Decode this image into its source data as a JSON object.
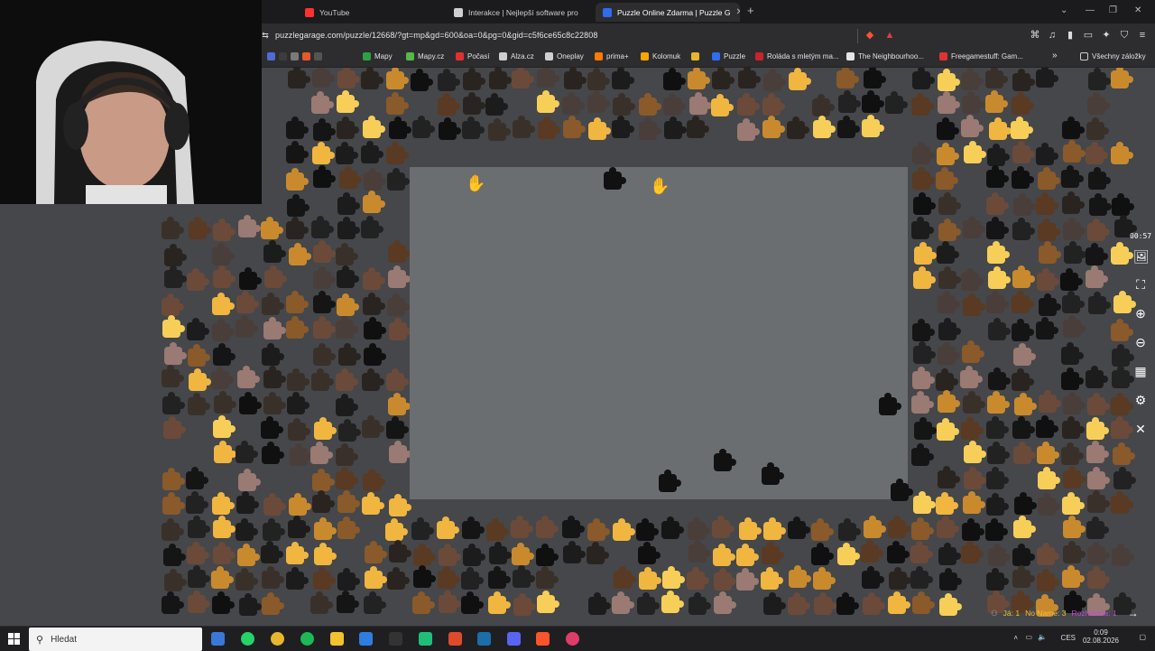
{
  "browser": {
    "tabs": [
      {
        "label": "YouTube",
        "color": "#ff3030",
        "active": false
      },
      {
        "label": "Interakce | Nejlepší software pro",
        "color": "#cfcfcf",
        "active": false
      },
      {
        "label": "Puzzle Online Zdarma | Puzzle G",
        "color": "#2f6cf0",
        "active": true
      }
    ],
    "new_tab_label": "+",
    "url": "puzzlegarage.com/puzzle/12668/?gt=mp&gd=600&oa=0&pg=0&gid=c5f6ce65c8c22808",
    "bookmarks": [
      {
        "label": "Mapy",
        "color": "#2ea043"
      },
      {
        "label": "Mapy.cz",
        "color": "#56b947"
      },
      {
        "label": "Počasí",
        "color": "#e2312d"
      },
      {
        "label": "Alza.cz",
        "color": "#cfcfcf"
      },
      {
        "label": "Oneplay",
        "color": "#cfcfcf"
      },
      {
        "label": "prima+",
        "color": "#ff7a00"
      },
      {
        "label": "Kolomuk",
        "color": "#ffa500"
      },
      {
        "label": "Puzzle",
        "color": "#2f6cf0"
      },
      {
        "label": "Roláda s mletým ma...",
        "color": "#c7242e"
      },
      {
        "label": "The Neighbourhoo...",
        "color": "#e5e5e5"
      },
      {
        "label": "Freegamestuff: Gam...",
        "color": "#d33"
      }
    ],
    "bookmarks_more": "»",
    "all_bookmarks": "Všechny záložky"
  },
  "puzzle": {
    "timer": "00:57",
    "tools": [
      "image-icon",
      "fullscreen-icon",
      "zoom-in-icon",
      "zoom-out-icon",
      "grid-icon",
      "settings-icon",
      "close-icon"
    ],
    "players": [
      {
        "name": "Já:",
        "score": "1",
        "color": "#f1c232"
      },
      {
        "name": "No Name:",
        "score": "3",
        "color": "#f1c232"
      },
      {
        "name": "Rozhledna:",
        "score": "1",
        "color": "#c24bd8"
      }
    ],
    "exit_label": "→"
  },
  "taskbar": {
    "search_placeholder": "Hledat",
    "language": "CES",
    "time": "0:09",
    "date": "02.08.2026"
  }
}
